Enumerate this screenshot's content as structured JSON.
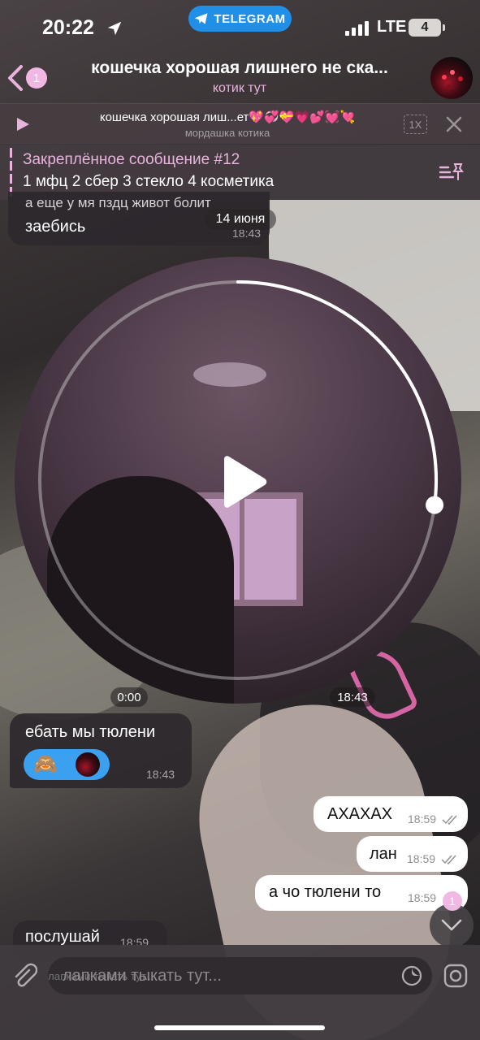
{
  "status_bar": {
    "time": "20:22",
    "app_pill": "TELEGRAM",
    "network": "LTE",
    "battery": "4"
  },
  "header": {
    "unread_count": "1",
    "title": "кошечка хорошая лишнего не ска...",
    "subtitle": "котик тут"
  },
  "player": {
    "title": "кошечка хорошая лиш...ет💖💞💝💗💕💓💘",
    "subtitle": "мордашка котика",
    "speed": "1X"
  },
  "pinned": {
    "title": "Закреплённое сообщение #12",
    "text": "1 мфц 2 сбер 3 стекло 4 косметика"
  },
  "date_separator": "14 июня",
  "messages": [
    {
      "direction": "in",
      "reply": "а еще у мя пздц живот болит",
      "text": "заебись",
      "time": "18:43"
    },
    {
      "direction": "in",
      "type": "video_note",
      "duration": "0:00",
      "time": "18:43",
      "progress": 0.27
    },
    {
      "direction": "in",
      "text": "ебать мы тюлени",
      "time": "18:43",
      "reaction_emoji": "🙈"
    },
    {
      "direction": "out",
      "text": "АХАХАХ",
      "time": "18:59"
    },
    {
      "direction": "out",
      "text": "лан",
      "time": "18:59"
    },
    {
      "direction": "out",
      "text": "а чо тюлени то",
      "time": "18:59"
    },
    {
      "direction": "in",
      "text": "послушай",
      "time": "18:59"
    }
  ],
  "scroll_badge": "1",
  "composer": {
    "placeholder": "лапками тыкать тут..."
  },
  "colors": {
    "accent_pink": "#e8b4dd",
    "badge_pink": "#f0b9e3",
    "telegram_blue": "#1f8fe8",
    "reaction_blue": "#3ba0ef"
  }
}
